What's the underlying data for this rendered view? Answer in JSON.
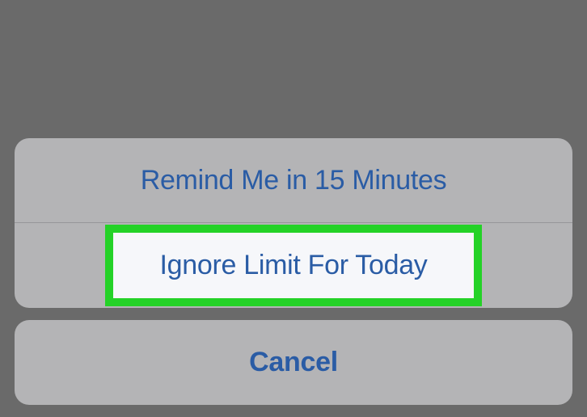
{
  "actionSheet": {
    "options": [
      {
        "label": "Remind Me in 15 Minutes"
      },
      {
        "label": "Ignore Limit For Today"
      }
    ],
    "cancel": {
      "label": "Cancel"
    }
  }
}
